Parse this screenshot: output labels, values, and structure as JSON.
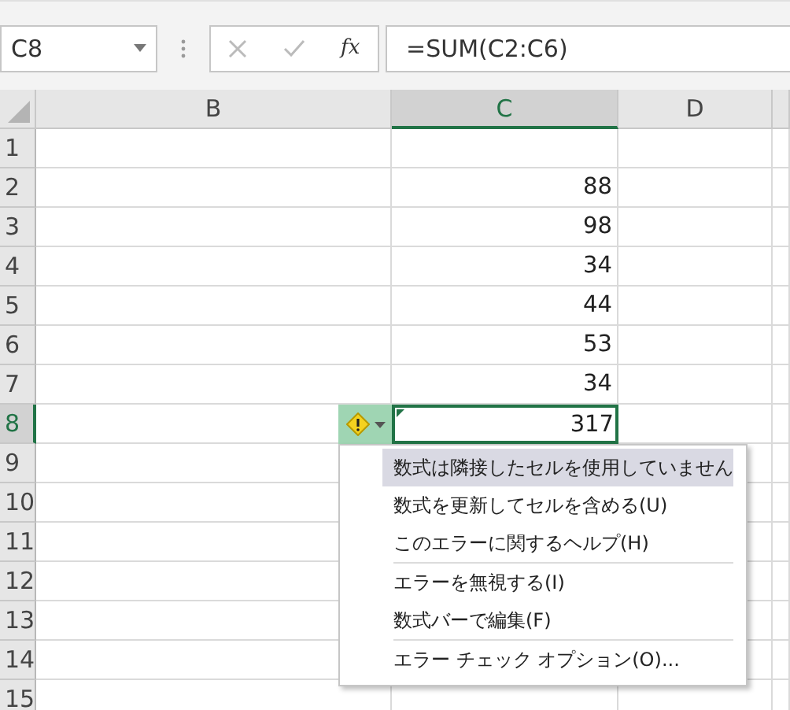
{
  "name_box": {
    "value": "C8"
  },
  "formula_bar": {
    "fx_label": "fx",
    "value": "=SUM(C2:C6)"
  },
  "columns": [
    {
      "label": "B",
      "selected": false
    },
    {
      "label": "C",
      "selected": true
    },
    {
      "label": "D",
      "selected": false
    }
  ],
  "rows": [
    {
      "label": "1",
      "selected": false
    },
    {
      "label": "2",
      "selected": false,
      "c": "88"
    },
    {
      "label": "3",
      "selected": false,
      "c": "98"
    },
    {
      "label": "4",
      "selected": false,
      "c": "34"
    },
    {
      "label": "5",
      "selected": false,
      "c": "44"
    },
    {
      "label": "6",
      "selected": false,
      "c": "53"
    },
    {
      "label": "7",
      "selected": false,
      "c": "34"
    },
    {
      "label": "8",
      "selected": true,
      "c": "317"
    },
    {
      "label": "9",
      "selected": false
    },
    {
      "label": "10",
      "selected": false
    },
    {
      "label": "11",
      "selected": false
    },
    {
      "label": "12",
      "selected": false
    },
    {
      "label": "13",
      "selected": false
    },
    {
      "label": "14",
      "selected": false
    },
    {
      "label": "15",
      "selected": false
    }
  ],
  "error_menu": {
    "items": [
      {
        "label": "数式は隣接したセルを使用していません",
        "selected": true,
        "separator_before": false
      },
      {
        "label": "数式を更新してセルを含める(U)",
        "selected": false,
        "separator_before": false
      },
      {
        "label": "このエラーに関するヘルプ(H)",
        "selected": false,
        "separator_before": false
      },
      {
        "label": "エラーを無視する(I)",
        "selected": false,
        "separator_before": true
      },
      {
        "label": "数式バーで編集(F)",
        "selected": false,
        "separator_before": false
      },
      {
        "label": "エラー チェック オプション(O)...",
        "selected": false,
        "separator_before": true
      }
    ]
  }
}
